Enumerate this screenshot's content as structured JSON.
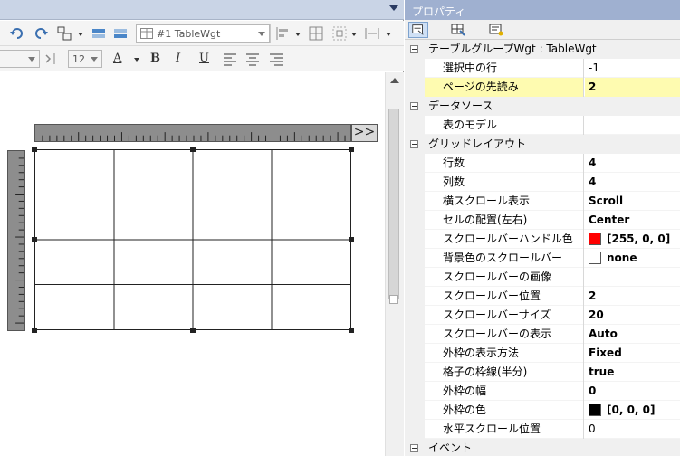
{
  "toolbar": {
    "widget_combo": "#1 TableWgt",
    "font_size": "12",
    "format_labels": [
      "A",
      "B",
      "I",
      "U"
    ]
  },
  "canvas": {
    "expand_button": ">>",
    "grid": {
      "rows": 4,
      "cols": 4
    }
  },
  "panel": {
    "title": "プロパティ",
    "rows": [
      {
        "kind": "cat",
        "name": "テーブルグループWgt : TableWgt"
      },
      {
        "kind": "prop",
        "name": "選択中の行",
        "value": "-1",
        "bold": false
      },
      {
        "kind": "prop",
        "name": "ページの先読み",
        "value": "2",
        "bold": true,
        "selected": true
      },
      {
        "kind": "cat",
        "name": "データソース"
      },
      {
        "kind": "prop",
        "name": "表のモデル",
        "value": "",
        "bold": false
      },
      {
        "kind": "cat",
        "name": "グリッドレイアウト"
      },
      {
        "kind": "prop",
        "name": "行数",
        "value": "4",
        "bold": true
      },
      {
        "kind": "prop",
        "name": "列数",
        "value": "4",
        "bold": true
      },
      {
        "kind": "prop",
        "name": "横スクロール表示",
        "value": "Scroll",
        "bold": true
      },
      {
        "kind": "prop",
        "name": "セルの配置(左右)",
        "value": "Center",
        "bold": true
      },
      {
        "kind": "prop",
        "name": "スクロールバーハンドル色",
        "value": "[255, 0, 0]",
        "bold": true,
        "swatch": "#ff0000"
      },
      {
        "kind": "prop",
        "name": "背景色のスクロールバー",
        "value": "none",
        "bold": true,
        "swatch": "#ffffff"
      },
      {
        "kind": "prop",
        "name": "スクロールバーの画像",
        "value": "",
        "bold": false
      },
      {
        "kind": "prop",
        "name": "スクロールバー位置",
        "value": "2",
        "bold": true
      },
      {
        "kind": "prop",
        "name": "スクロールバーサイズ",
        "value": "20",
        "bold": true
      },
      {
        "kind": "prop",
        "name": "スクロールバーの表示",
        "value": "Auto",
        "bold": true
      },
      {
        "kind": "prop",
        "name": "外枠の表示方法",
        "value": "Fixed",
        "bold": true
      },
      {
        "kind": "prop",
        "name": "格子の枠線(半分)",
        "value": "true",
        "bold": true
      },
      {
        "kind": "prop",
        "name": "外枠の幅",
        "value": "0",
        "bold": true
      },
      {
        "kind": "prop",
        "name": "外枠の色",
        "value": "[0, 0, 0]",
        "bold": true,
        "swatch": "#000000"
      },
      {
        "kind": "prop",
        "name": "水平スクロール位置",
        "value": "0",
        "bold": false
      },
      {
        "kind": "cat",
        "name": "イベント"
      }
    ]
  }
}
